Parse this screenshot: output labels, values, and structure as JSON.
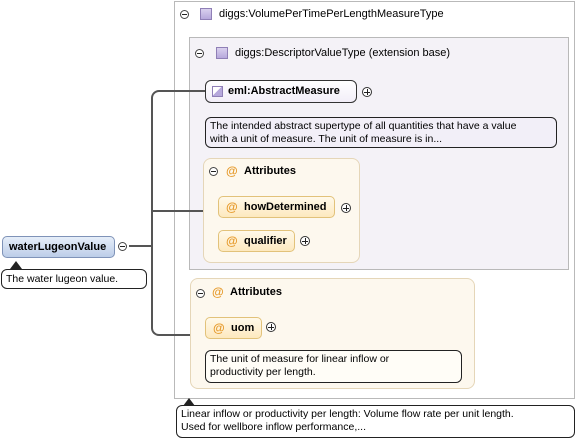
{
  "root_element": {
    "name": "waterLugeonValue",
    "doc": "The water lugeon value."
  },
  "complex_type": {
    "name": "diggs:VolumePerTimePerLengthMeasureType",
    "doc_line1": "Linear inflow or productivity per length: Volume flow rate per unit length.",
    "doc_line2": "Used for wellbore inflow performance,..."
  },
  "base_type": {
    "name": "diggs:DescriptorValueType (extension base)"
  },
  "abstract_measure": {
    "name": "eml:AbstractMeasure",
    "doc_line1": "The intended abstract supertype of all quantities that have a value",
    "doc_line2": "with a unit of measure. The unit of measure is in..."
  },
  "inner_attributes": {
    "symbol": "@",
    "title": "Attributes",
    "items": [
      "howDetermined",
      "qualifier"
    ]
  },
  "outer_attributes": {
    "symbol": "@",
    "title": "Attributes",
    "uom": {
      "name": "uom",
      "doc_line1": "The unit of measure for linear inflow or",
      "doc_line2": "productivity per length."
    }
  },
  "icons": [
    "collapse-icon",
    "expand-icon",
    "complex-type-icon",
    "abstract-element-icon",
    "attribute-icon"
  ]
}
